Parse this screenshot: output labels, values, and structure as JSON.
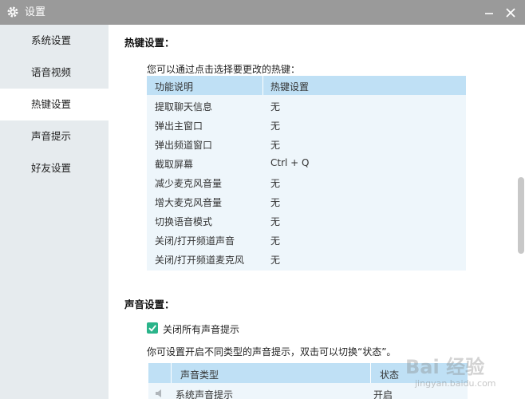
{
  "window": {
    "title": "设置"
  },
  "sidebar": {
    "items": [
      {
        "label": "系统设置"
      },
      {
        "label": "语音视频"
      },
      {
        "label": "热键设置",
        "active": true
      },
      {
        "label": "声音提示"
      },
      {
        "label": "好友设置"
      }
    ]
  },
  "hotkeys": {
    "title": "热键设置：",
    "intro": "您可以通过点击选择要更改的热键：",
    "columns": [
      "功能说明",
      "热键设置"
    ],
    "rows": [
      {
        "function": "提取聊天信息",
        "key": "无"
      },
      {
        "function": "弹出主窗口",
        "key": "无"
      },
      {
        "function": "弹出频道窗口",
        "key": "无"
      },
      {
        "function": "截取屏幕",
        "key": "Ctrl + Q"
      },
      {
        "function": "减少麦克风音量",
        "key": "无"
      },
      {
        "function": "增大麦克风音量",
        "key": "无"
      },
      {
        "function": "切换语音模式",
        "key": "无"
      },
      {
        "function": "关闭/打开频道声音",
        "key": "无"
      },
      {
        "function": "关闭/打开频道麦克风",
        "key": "无"
      }
    ]
  },
  "sound": {
    "title": "声音设置：",
    "checkbox_label": "关闭所有声音提示",
    "checked": true,
    "intro": "你可设置开启不同类型的声音提示，双击可以切换“状态”。",
    "columns": [
      "声音类型",
      "状态"
    ],
    "rows": [
      {
        "type": "系统声音提示",
        "status": "开启"
      }
    ]
  },
  "watermark": {
    "text": "Bai 经验",
    "sub": "jingyan.baidu.com"
  },
  "colors": {
    "titlebar": "#9a9a9a",
    "sidebar": "#e6ebee",
    "table_header": "#bfe0f5",
    "table_body": "#eef6fb",
    "checkbox": "#2ab48a"
  }
}
